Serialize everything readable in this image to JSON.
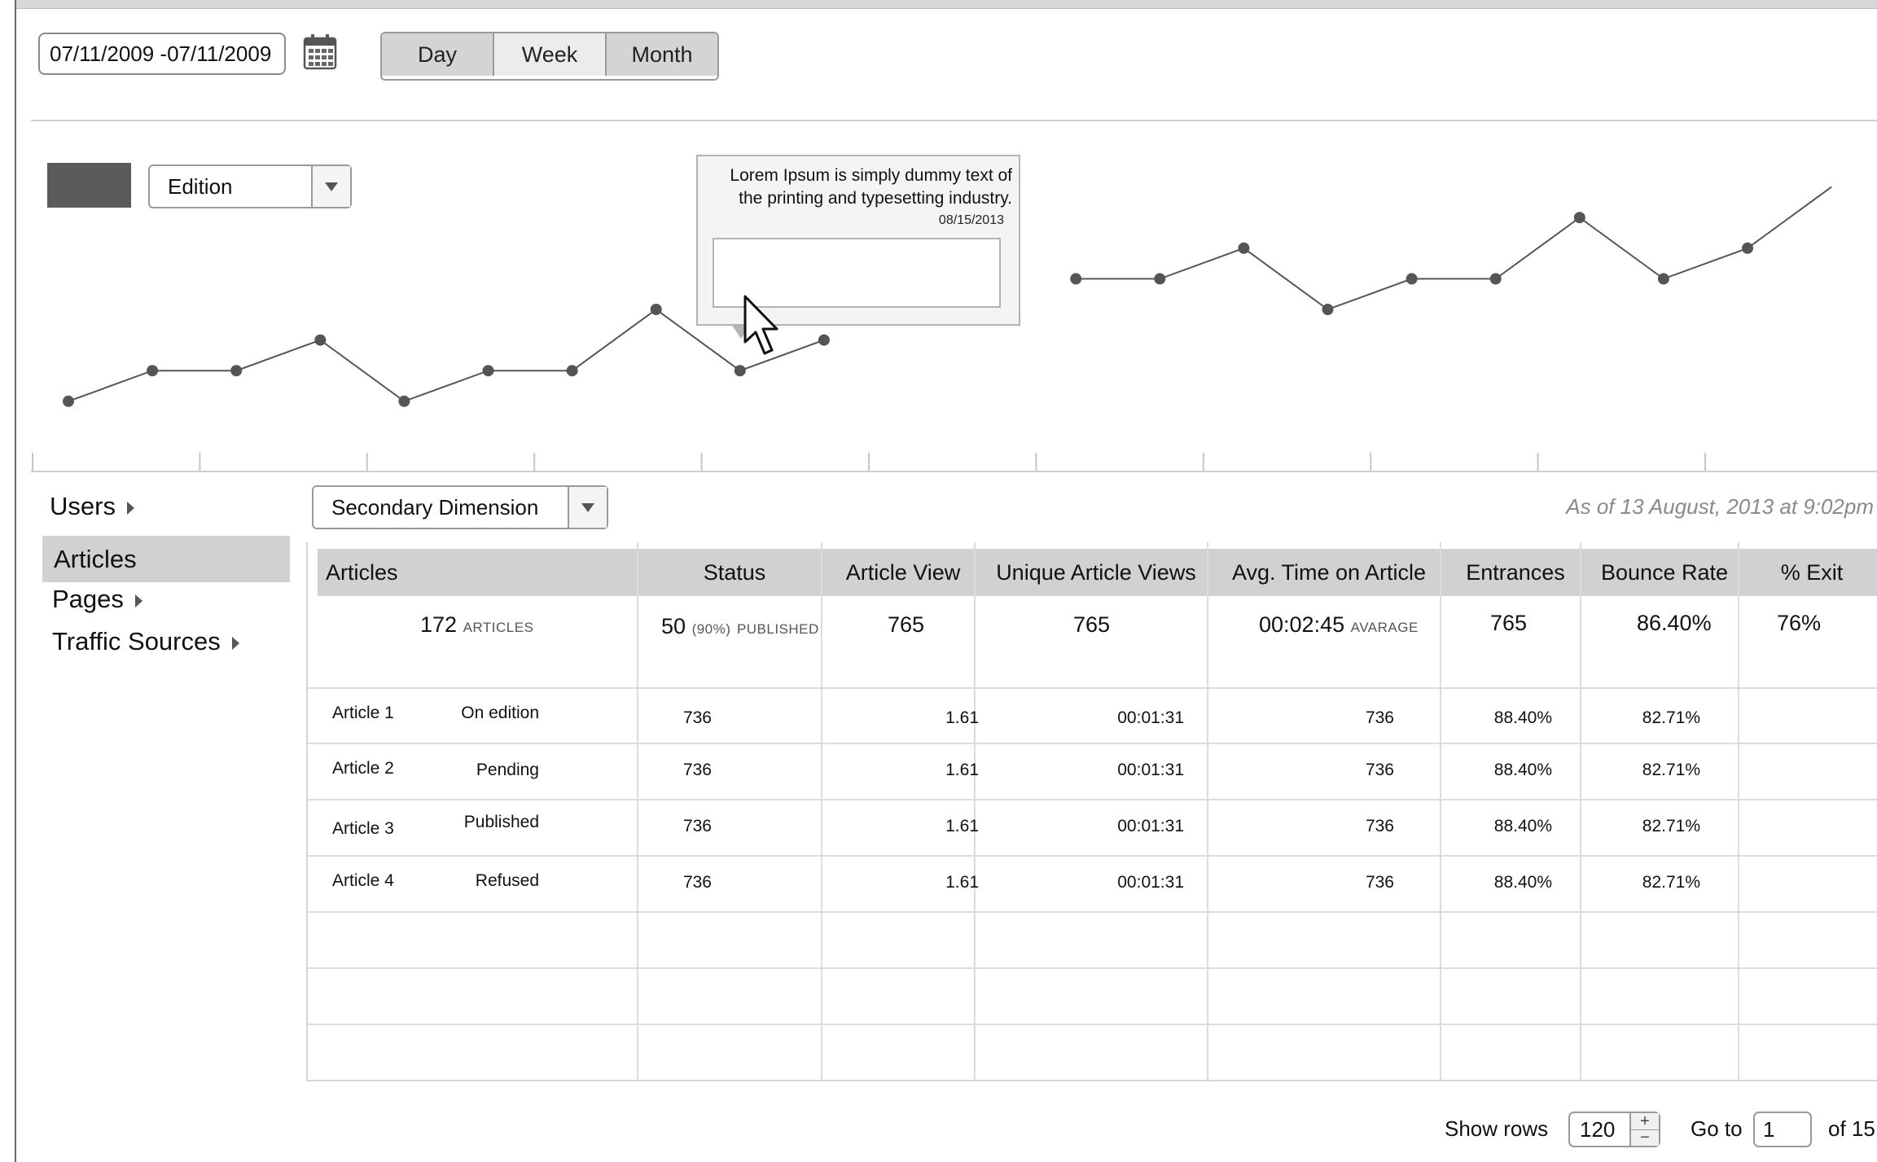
{
  "date_range": {
    "value": "07/11/2009 -07/11/2009"
  },
  "period": {
    "day": "Day",
    "week": "Week",
    "month": "Month"
  },
  "chart_controls": {
    "metric_select": "Edition"
  },
  "tooltip": {
    "text": "Lorem Ipsum is simply dummy text of the printing and typesetting industry.",
    "date": "08/15/2013"
  },
  "chart_data": {
    "type": "line",
    "x_ticks": 11,
    "values": [
      2,
      3,
      3,
      4,
      2,
      3,
      3,
      5,
      3,
      4,
      null,
      null,
      6,
      6,
      7,
      5,
      6,
      6,
      8,
      6,
      7,
      9
    ],
    "grid": false
  },
  "sidebar": {
    "users": "Users",
    "articles": "Articles",
    "pages": "Pages",
    "traffic_sources": "Traffic Sources"
  },
  "secondary_dimension": {
    "label": "Secondary Dimension"
  },
  "as_of": "As of 13 August, 2013 at 9:02pm",
  "table": {
    "headers": [
      "Articles",
      "Status",
      "Article View",
      "Unique Article Views",
      "Avg. Time on Article",
      "Entrances",
      "Bounce Rate",
      "% Exit"
    ],
    "summary": {
      "articles_value": "172",
      "articles_unit": "ARTICLES",
      "status_value": "50",
      "status_pct": "(90%)",
      "status_unit": "PUBLISHED",
      "article_view": "765",
      "unique_views": "765",
      "avg_time": "00:02:45",
      "avg_unit": "AVARAGE",
      "entrances": "765",
      "bounce_rate": "86.40%",
      "exit": "76%"
    },
    "rows": [
      {
        "name": "Article 1",
        "status": "On edition",
        "view": "736",
        "unique": "1.61",
        "time": "00:01:31",
        "entrances": "736",
        "bounce": "88.40%",
        "exit": "82.71%"
      },
      {
        "name": "Article 2",
        "status": "Pending",
        "view": "736",
        "unique": "1.61",
        "time": "00:01:31",
        "entrances": "736",
        "bounce": "88.40%",
        "exit": "82.71%"
      },
      {
        "name": "Article 3",
        "status": "Published",
        "view": "736",
        "unique": "1.61",
        "time": "00:01:31",
        "entrances": "736",
        "bounce": "88.40%",
        "exit": "82.71%"
      },
      {
        "name": "Article 4",
        "status": "Refused",
        "view": "736",
        "unique": "1.61",
        "time": "00:01:31",
        "entrances": "736",
        "bounce": "88.40%",
        "exit": "82.71%"
      }
    ]
  },
  "footer": {
    "show_rows_label": "Show rows",
    "rows_value": "120",
    "goto_label": "Go to",
    "page_value": "1",
    "of_label": "of 15"
  }
}
